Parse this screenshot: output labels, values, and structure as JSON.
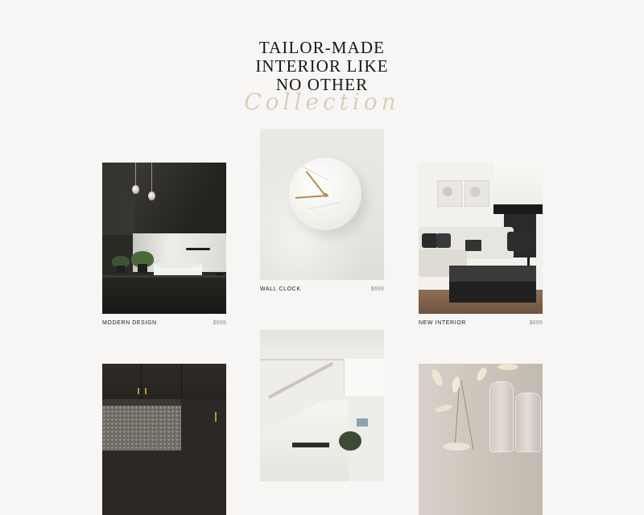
{
  "hero": {
    "title_lines": [
      "TAILOR-MADE",
      "INTERIOR LIKE",
      "NO OTHER"
    ],
    "script": "Collection"
  },
  "products": [
    {
      "name": "MODERN DESIGN",
      "price": "$699"
    },
    {
      "name": "WALL CLOCK",
      "price": "$699"
    },
    {
      "name": "NEW INTERIOR",
      "price": "$699"
    }
  ],
  "colors": {
    "background": "#f7f6f4",
    "text": "#161616",
    "price": "#8d8d8d",
    "script_accent": "#d9cbb4",
    "clock_hands": "#b88b45"
  }
}
